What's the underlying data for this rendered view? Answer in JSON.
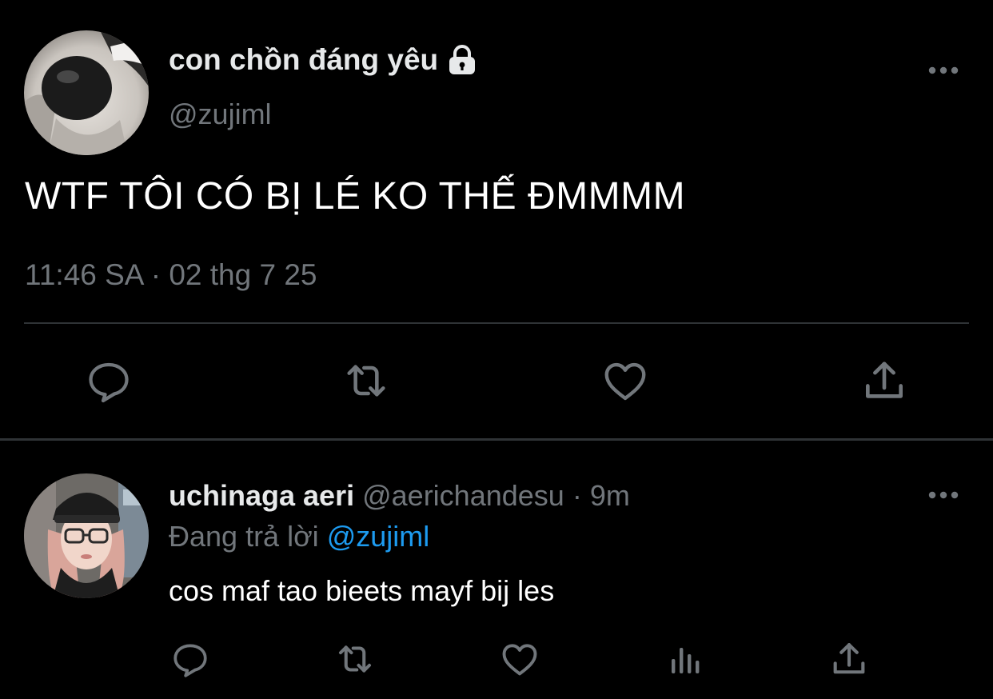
{
  "main_tweet": {
    "author_name": "con chồn đáng yêu",
    "author_handle": "@zujiml",
    "protected_icon": "lock-icon",
    "text": "WTF TÔI CÓ BỊ LÉ KO THẾ ĐMMMM",
    "time": "11:46 SA",
    "separator": "·",
    "date": "02 thg 7 25",
    "actions": [
      "reply-icon",
      "retweet-icon",
      "like-icon",
      "share-icon"
    ]
  },
  "reply": {
    "author_name": "uchinaga aeri",
    "author_handle": "@aerichandesu",
    "separator": "·",
    "age": "9m",
    "replying_prefix": "Đang trả lời",
    "replying_to": "@zujiml",
    "text": "cos maf tao bieets mayf bij les",
    "actions": [
      "reply-icon",
      "retweet-icon",
      "like-icon",
      "views-icon",
      "share-icon"
    ]
  },
  "colors": {
    "background": "#000000",
    "primary_text": "#e7e9ea",
    "secondary_text": "#71767b",
    "link": "#1d9bf0",
    "divider": "#2f3336"
  }
}
